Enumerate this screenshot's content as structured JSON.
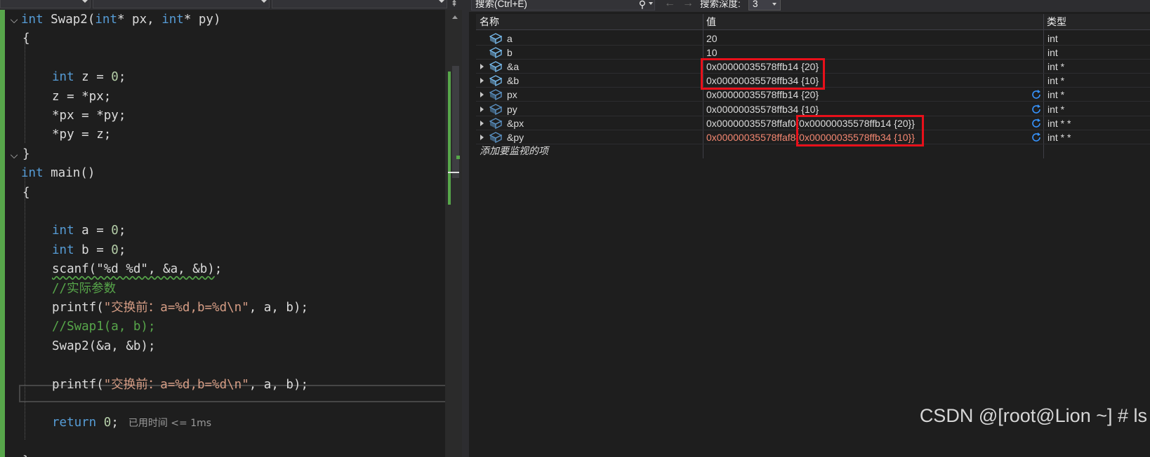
{
  "editor": {
    "elapsed": "已用时间 <= 1ms",
    "split_glyph": "⇞",
    "lines": [
      [
        [
          "kw",
          "int"
        ],
        [
          "",
          " Swap2("
        ],
        [
          "kw",
          "int"
        ],
        [
          "",
          "* px, "
        ],
        [
          "kw",
          "int"
        ],
        [
          "",
          "* py)"
        ]
      ],
      [
        [
          "",
          "{"
        ]
      ],
      [],
      [
        [
          "kw",
          "int"
        ],
        [
          "",
          " z = "
        ],
        [
          "num",
          "0"
        ],
        [
          "",
          ";"
        ]
      ],
      [
        [
          "",
          "z = *px;"
        ]
      ],
      [
        [
          "",
          "*px = *py;"
        ]
      ],
      [
        [
          "",
          "*py = z;"
        ]
      ],
      [
        [
          "",
          "}"
        ]
      ],
      [
        [
          "kw",
          "int"
        ],
        [
          "",
          " main()"
        ]
      ],
      [
        [
          "",
          "{"
        ]
      ],
      [],
      [
        [
          "kw",
          "int"
        ],
        [
          "",
          " a = "
        ],
        [
          "num",
          "0"
        ],
        [
          "",
          ";"
        ]
      ],
      [
        [
          "kw",
          "int"
        ],
        [
          "",
          " b = "
        ],
        [
          "num",
          "0"
        ],
        [
          "",
          ";"
        ]
      ],
      [
        [
          "sq",
          "scanf(\"%d %d\", &a, &b)"
        ],
        [
          "",
          ";"
        ]
      ],
      [
        [
          "cmt",
          "//实际参数"
        ]
      ],
      [
        [
          "",
          "printf("
        ],
        [
          "str",
          "\"交换前：a=%d,b=%d\\n\""
        ],
        [
          "",
          ", a, b);"
        ]
      ],
      [
        [
          "cmt",
          "//Swap1(a, b);"
        ]
      ],
      [
        [
          "",
          "Swap2(&a, &b);"
        ]
      ],
      [],
      [
        [
          "",
          "printf("
        ],
        [
          "str",
          "\"交换前：a=%d,b=%d\\n\""
        ],
        [
          "",
          ", a, b);"
        ]
      ],
      [],
      [
        [
          "kw",
          "return"
        ],
        [
          "",
          " "
        ],
        [
          "num",
          "0"
        ],
        [
          "",
          ";"
        ]
      ],
      [],
      [
        [
          "",
          "}"
        ]
      ]
    ]
  },
  "watch": {
    "search_placeholder": "搜索(Ctrl+E)",
    "search_icon_glyph": "⚲",
    "nav_back_glyph": "←",
    "nav_forward_glyph": "→",
    "depth_label": "搜索深度:",
    "depth_value": "3",
    "columns": {
      "name": "名称",
      "value": "值",
      "type": "类型"
    },
    "add_watch": "添加要监视的项",
    "rows": [
      {
        "name": "a",
        "value": "20",
        "value2": "",
        "type": "int",
        "expandable": false,
        "stale": false,
        "changed": false
      },
      {
        "name": "b",
        "value": "10",
        "value2": "",
        "type": "int",
        "expandable": false,
        "stale": false,
        "changed": false
      },
      {
        "name": "&a",
        "value": "0x00000035578ffb14 {20}",
        "value2": "",
        "type": "int *",
        "expandable": true,
        "stale": false,
        "changed": false
      },
      {
        "name": "&b",
        "value": "0x00000035578ffb34 {10}",
        "value2": "",
        "type": "int *",
        "expandable": true,
        "stale": false,
        "changed": false
      },
      {
        "name": "px",
        "value": "0x00000035578ffb14 {20}",
        "value2": "",
        "type": "int *",
        "expandable": true,
        "stale": true,
        "changed": false
      },
      {
        "name": "py",
        "value": "0x00000035578ffb34 {10}",
        "value2": "",
        "type": "int *",
        "expandable": true,
        "stale": true,
        "changed": false
      },
      {
        "name": "&px",
        "value": "0x00000035578ffaf0",
        "value2": "{0x00000035578ffb14 {20}}",
        "type": "int * *",
        "expandable": true,
        "stale": true,
        "changed": false
      },
      {
        "name": "&py",
        "value": "0x00000035578ffaf8",
        "value2": "{0x00000035578ffb34 {10}}",
        "type": "int * *",
        "expandable": true,
        "stale": true,
        "changed": true
      }
    ]
  },
  "watermark": "CSDN @[root@Lion ~] # ls"
}
